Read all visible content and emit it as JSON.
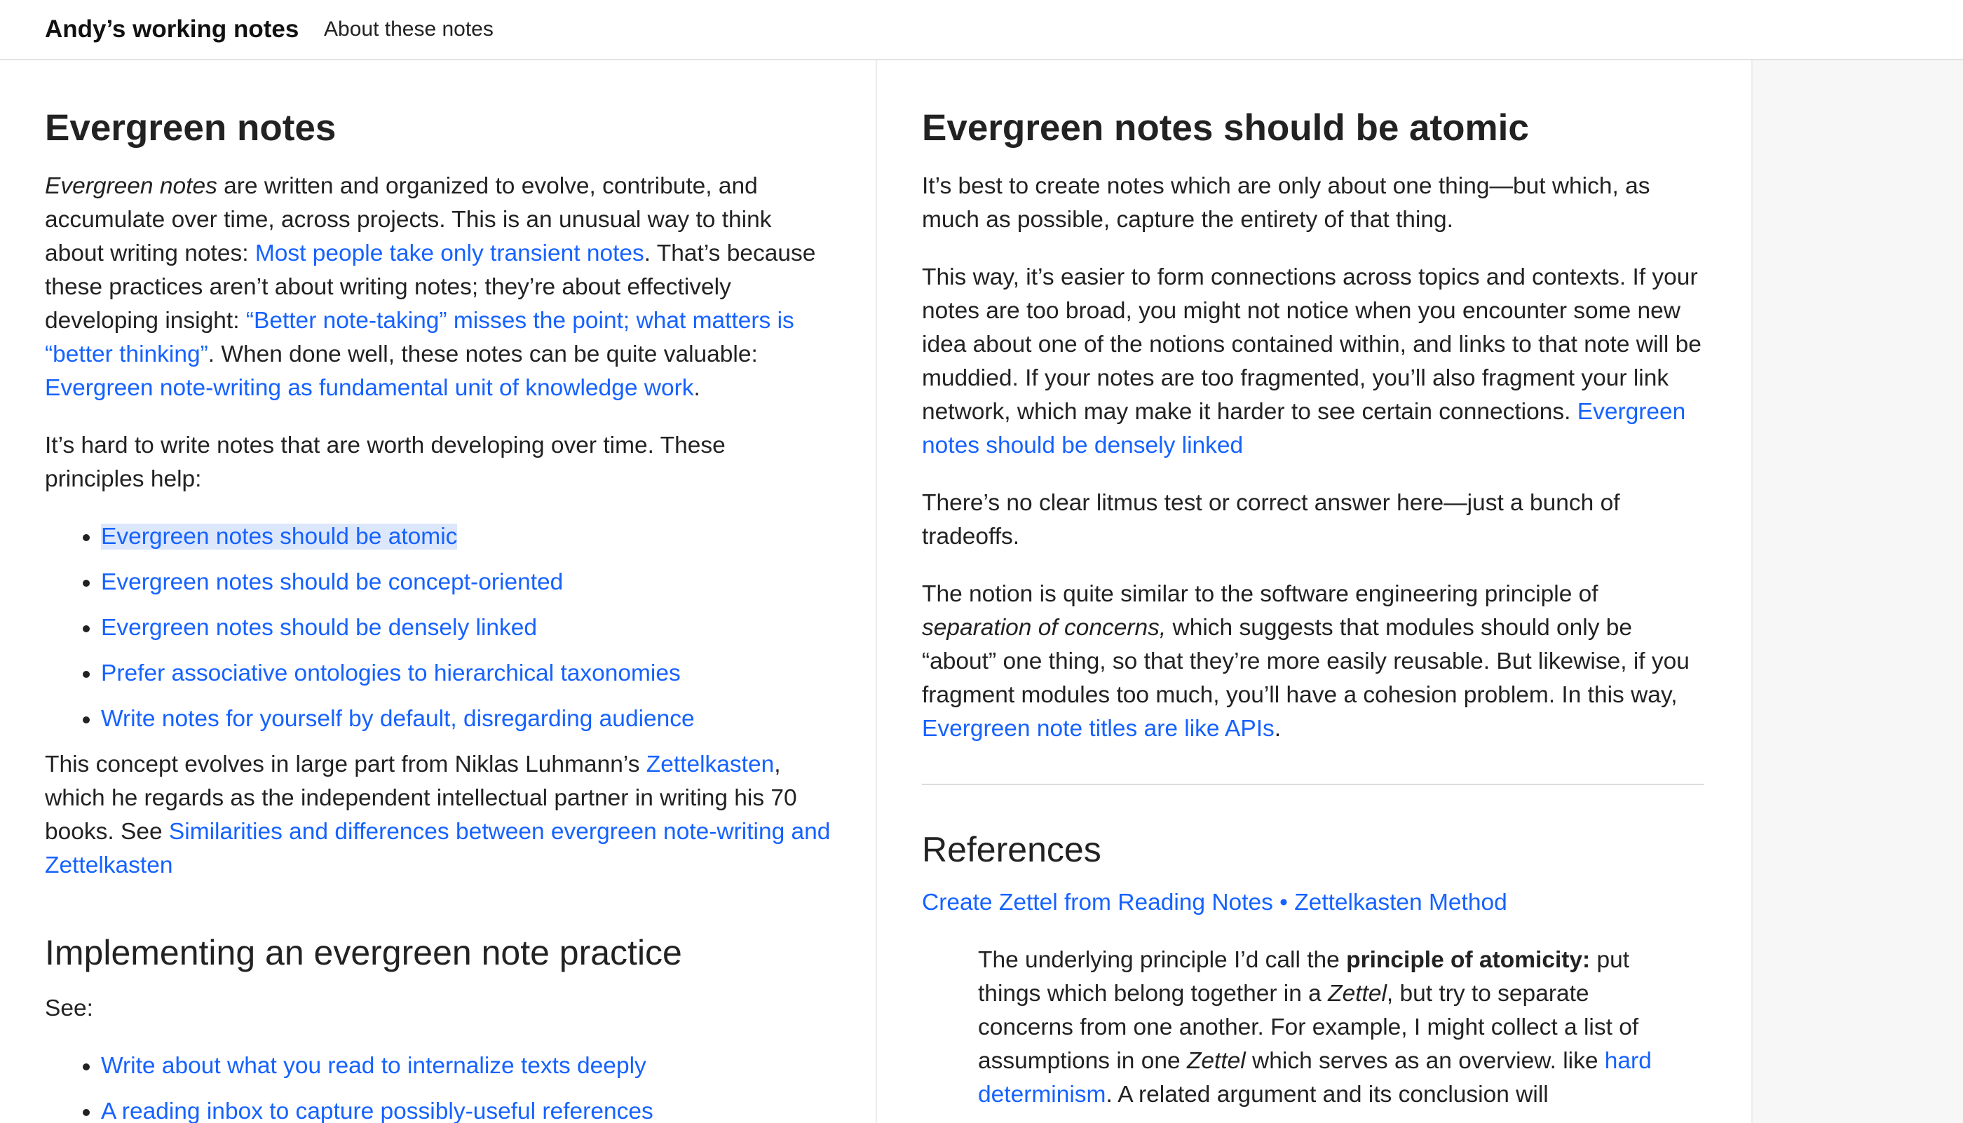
{
  "header": {
    "title": "Andy’s working notes",
    "nav": [
      "About these notes"
    ]
  },
  "left": {
    "title": "Evergreen notes",
    "blocks": [
      {
        "type": "p",
        "segs": [
          {
            "t": "Evergreen notes",
            "em": true
          },
          {
            "t": " are written and organized to evolve, contribute, and accumulate over time, across projects. This is an unusual way to think about writing notes: "
          },
          {
            "t": "Most people take only transient notes",
            "link": true
          },
          {
            "t": ". That’s because these practices aren’t about writing notes; they’re about effectively developing insight: "
          },
          {
            "t": "“Better note-taking” misses the point; what matters is “better thinking”",
            "link": true
          },
          {
            "t": ". When done well, these notes can be quite valuable: "
          },
          {
            "t": "Evergreen note-writing as fundamental unit of knowledge work",
            "link": true
          },
          {
            "t": "."
          }
        ]
      },
      {
        "type": "p",
        "segs": [
          {
            "t": "It’s hard to write notes that are worth developing over time. These principles help:"
          }
        ]
      },
      {
        "type": "ul",
        "items": [
          {
            "t": "Evergreen notes should be atomic",
            "link": true,
            "hl": true
          },
          {
            "t": "Evergreen notes should be concept-oriented",
            "link": true
          },
          {
            "t": "Evergreen notes should be densely linked",
            "link": true
          },
          {
            "t": "Prefer associative ontologies to hierarchical taxonomies",
            "link": true
          },
          {
            "t": "Write notes for yourself by default, disregarding audience",
            "link": true
          }
        ]
      },
      {
        "type": "p",
        "segs": [
          {
            "t": "This concept evolves in large part from Niklas Luhmann’s "
          },
          {
            "t": "Zettelkasten",
            "link": true
          },
          {
            "t": ", which he regards as the independent intellectual partner in writing his 70 books. See "
          },
          {
            "t": "Similarities and differences between evergreen note-writing and Zettelkasten",
            "link": true
          }
        ]
      },
      {
        "type": "h2",
        "t": "Implementing an evergreen note practice"
      },
      {
        "type": "p",
        "segs": [
          {
            "t": "See:"
          }
        ]
      },
      {
        "type": "ul",
        "items": [
          {
            "t": "Write about what you read to internalize texts deeply",
            "link": true
          },
          {
            "t": "A reading inbox to capture possibly-useful references",
            "link": true
          }
        ]
      }
    ]
  },
  "right": {
    "title": "Evergreen notes should be atomic",
    "blocks": [
      {
        "type": "p",
        "segs": [
          {
            "t": "It’s best to create notes which are only about one thing—but which, as much as possible, capture the entirety of that thing."
          }
        ]
      },
      {
        "type": "p",
        "segs": [
          {
            "t": "This way, it’s easier to form connections across topics and contexts. If your notes are too broad, you might not notice when you encounter some new idea about one of the notions contained within, and links to that note will be muddied. If your notes are too fragmented, you’ll also fragment your link network, which may make it harder to see certain connections. "
          },
          {
            "t": "Evergreen notes should be densely linked",
            "link": true
          }
        ]
      },
      {
        "type": "p",
        "segs": [
          {
            "t": "There’s no clear litmus test or correct answer here—just a bunch of tradeoffs."
          }
        ]
      },
      {
        "type": "p",
        "segs": [
          {
            "t": "The notion is quite similar to the software engineering principle of "
          },
          {
            "t": "separation of concerns,",
            "em": true
          },
          {
            "t": " which suggests that modules should only be “about” one thing, so that they’re more easily reusable. But likewise, if you fragment modules too much, you’ll have a cohesion problem. In this way, "
          },
          {
            "t": "Evergreen note titles are like APIs",
            "link": true
          },
          {
            "t": "."
          }
        ]
      }
    ],
    "references": {
      "title": "References",
      "source": [
        {
          "t": "Create Zettel from Reading Notes • Zettelkasten Method",
          "link": true
        }
      ],
      "quote": [
        {
          "t": "The underlying principle I’d call the "
        },
        {
          "t": "principle of atomicity:",
          "strong": true
        },
        {
          "t": " put things which belong together in a "
        },
        {
          "t": "Zettel",
          "em": true
        },
        {
          "t": ", but try to separate concerns from one another. For example, I might collect a list of assumptions in one "
        },
        {
          "t": "Zettel",
          "em": true
        },
        {
          "t": " which serves as an overview. like "
        },
        {
          "t": "hard determinism",
          "link": true
        },
        {
          "t": ". A related argument and its conclusion will"
        }
      ]
    }
  },
  "colors": {
    "link": "#1662ff",
    "text": "#222222",
    "highlight": "#dce7fb",
    "sidebar_bg": "#f7f7f7"
  }
}
